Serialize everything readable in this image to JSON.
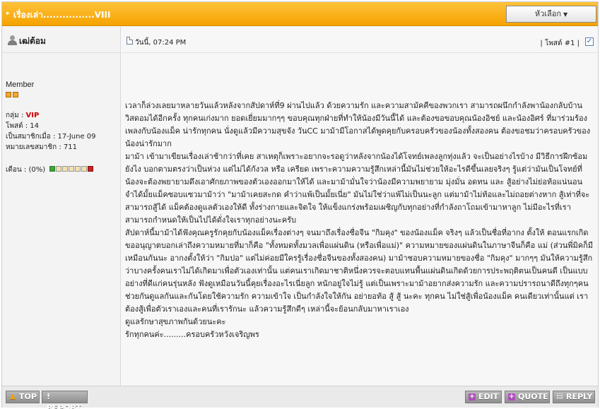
{
  "header": {
    "title": "เรื่องเล่า................VIII",
    "tools_label": "หัวเลือก"
  },
  "user": {
    "name": "เฒ่ต้อม",
    "title": "Member",
    "group_label": "กลุ่ม :",
    "group_value": "VIP",
    "posts": "โพสต์ : 14",
    "joined": "เป็นสมาชิกเมื่อ : 17-June 09",
    "member_no": "หมายเลขสมาชิก : 711",
    "reputation": "เตือน : (0%)",
    "reputation_percent": 0
  },
  "post": {
    "date": "วันนี้, 07:24 PM",
    "number": "| โพสต์ #1 |",
    "paragraphs": [
      "เวลาก็ล่วงเลยมาหลายวันแล้วหลังจากสัปดาห์ที่9 ผ่านไปแล้ว ด้วยความรัก และความสามัคคีของพวกเรา สามารถผนึกกำลังพาน้องกลับบ้านวิสดอมได้อีกครั้ง ทุกคนเก่งมาก ยอดเยี่ยมมากๆๆ ขอบคุณทุกฝ่ายที่ทำให้น้องมีวันนี้ได้ และต้องขอขอบคุณน้องอิชย์ และน้องอิศร์ ที่มาร่วมร้องเพลงกับน้องแม็ค น่ารักทุกคน นั่งดูแล้วมีความสุขจัง วันCC มาม้ามีโอกาสได้พูดคุยกับครอบครัวของน้องทั้งสองคน ต้องขอชมว่าครอบครัวของน้องน่ารักมาก",
      "มาม้า เข้ามาเขียนเรื่องเล่าช้ากว่าที่เคย สาเหตุก็เพราะอยากจะรอดูว่าหลังจากน้องได้โจทย์เพลงลูกทุ่งแล้ว จะเป็นอย่างไรบ้าง มีวิธีการฝึกซ้อมยังไง บอกตามตรงว่าเป็นห่วง แต่ไม่ได้กังวล หรือ เครียด เพราะความความรู้สึกเหล่านี้มันไม่ช่วยให้อะไรดีขึ้นเลยจริงๆ รู้แต่ว่ามันเป็นโจทย์ที่น้องจะต้องพยายามดึงเอาศักยภาพของตัวเองออกมาให้ได้ และมาม้ามั่นใจว่าน้องมีความพยายาม มุ่งมั่น อดทน และ สู้อย่างไม่ย่อท้อแน่นอน",
      "จำได้มั้ยแม็คซอบแซวมาม้าว่า \"มาม้าเคยสะกด คำว่าแพ้เป็นมั้ยเนี่ย\" มันไม่ใช่ว่าแพ้ไม่เป็นนะลูก แต่มาม้าไม่ท้อและไม่ถอยต่างหาก สู้เท่าที่จะสามารถสู้ได้ แม็คต้องดูแลตัวเองให้ดี ทั้งร่างกายและจิตใจ ให้แข็งแกร่งพร้อมเผชิญกับทุกอย่างที่กำลังถาโถมเข้ามาหาลูก ไม่มีอะไรที่เราสามารถกำหนดให้เป็นไปได้ดั่งใจเราทุกอย่างนะครับ",
      "สัปดาห์นี้มาม้าได้ฟังคุณครูรักคุยกับน้องแม็คเรื่องต่างๆ จนมาถึงเรื่องชื่อจีน \"กิมคุง\" ของน้องแม็ค จริงๆ แล้วเป็นชื่อที่อากง ตั้งให้ ตอนแรกเกิด ขออนุญาตบอกเล่าถึงความหมายที่มาก็คือ \"ทั้งหมดทั้งมวลเพื่อแผ่นดิน (หรือเพื่อแม่)\" ความหมายของแผ่นดินในภาษาจีนก็คือ แม่ (ส่วนพี่มิคก็มีเหมือนกันนะ อากงตั้งให้ว่า \"กิมปอ\" แต่ไม่ค่อยมีใครรู้เรื่องชื่อจีนของทั้งสองคน) มาม้าชอบความหมายของชื่อ \"กิมคุง\" มากๆๆ มันให้ความรู้สึกว่าบางครั้งคนเราไม่ได้เกิดมาเพื่อตัวเองเท่านั้น แต่คนเราเกิดมาชาติหนึ่งควรจะตอบแทนพื้นแผ่นดินเกิดด้วยการประพฤติตนเป็นคนดี เป็นแบบอย่างที่ดีแก่คนรุ่นหลัง ฟังดูเหมือนวันนี้คุยเรื่องอะไรเนี่ยลูก หนักอยู่ใจไม่รู้ แต่เป็นเพราะมาม้าอยากส่งความรัก และความปรารถนาดีถึงทุกๆคน ช่วยกันดูแลกันและกันโดยใช้ความรัก ความเข้าใจ เป็นกำลังใจให้กัน อย่ายอท้อ สู้ สู้ นะคะ ทุกคน ไม่ใช่สู้เพื่อน้องแม็ค คนเดียวเท่านั้นแต่ เราต้องสู้เพื่อตัวเราเองและคนที่เรารักนะ แล้วความรู้สึกดีๆ เหล่านี้จะย้อนกลับมาหาเราเอง",
      "ดูแลรักษาสุขภาพกันด้วยนะคะ",
      "รักทุกคนค่ะ.........ครอบครัวหวังเจริญพร"
    ]
  },
  "footer": {
    "top_label": "TOP",
    "report_label": "! REPORT",
    "edit_label": "EDIT",
    "quote_label": "QUOTE",
    "reply_label": "REPLY"
  },
  "icons": {
    "user": "user-icon",
    "post": "document-icon",
    "top": "arrow-up-icon",
    "edit": "plus-icon",
    "quote": "plus-icon",
    "reply": "page-icon"
  },
  "colors": {
    "header": "#f5a300",
    "vip": "#cc0000",
    "button": "#9c9c9c"
  }
}
